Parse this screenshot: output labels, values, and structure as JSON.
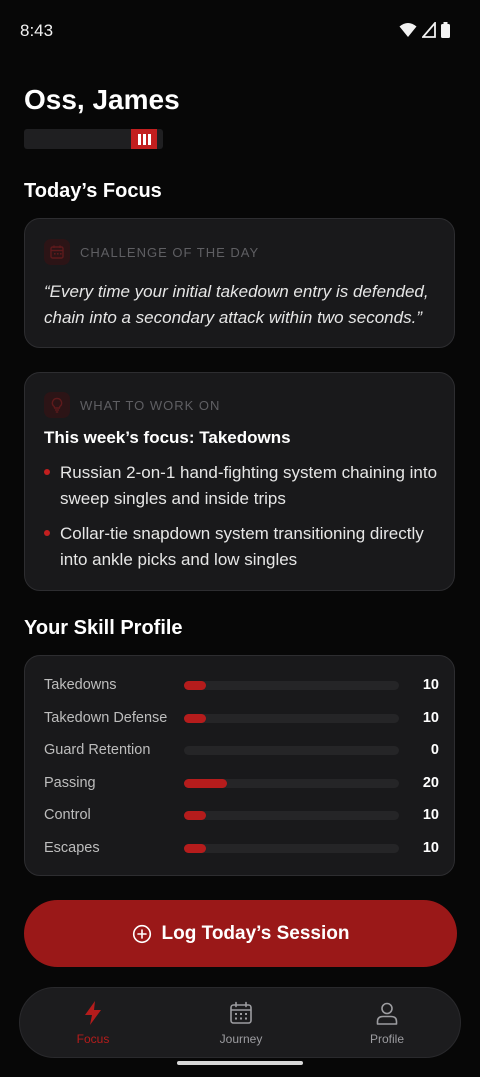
{
  "status": {
    "time": "8:43"
  },
  "header": {
    "greeting": "Oss, James"
  },
  "focus": {
    "title": "Today’s Focus",
    "challenge": {
      "label": "CHALLENGE OF THE DAY",
      "quote": "“Every time your initial takedown entry is defended, chain into a secondary attack within two seconds.”"
    },
    "work_on": {
      "label": "WHAT TO WORK ON",
      "heading": "This week’s focus: Takedowns",
      "items": [
        "Russian 2-on-1 hand-fighting system chaining into sweep singles and inside trips",
        "Collar-tie snapdown system transitioning directly into ankle picks and low singles"
      ]
    }
  },
  "skills": {
    "title": "Your Skill Profile",
    "items": [
      {
        "name": "Takedowns",
        "value": "10",
        "level": 10
      },
      {
        "name": "Takedown Defense",
        "value": "10",
        "level": 10
      },
      {
        "name": "Guard Retention",
        "value": "0",
        "level": 0
      },
      {
        "name": "Passing",
        "value": "20",
        "level": 20
      },
      {
        "name": "Control",
        "value": "10",
        "level": 10
      },
      {
        "name": "Escapes",
        "value": "10",
        "level": 10
      }
    ]
  },
  "action": {
    "log_label": "Log Today’s Session"
  },
  "nav": {
    "items": [
      {
        "label": "Focus",
        "icon": "lightning-bolt-icon",
        "active": true
      },
      {
        "label": "Journey",
        "icon": "calendar-icon",
        "active": false
      },
      {
        "label": "Profile",
        "icon": "person-icon",
        "active": false
      }
    ]
  },
  "colors": {
    "accent": "#b51c1c",
    "background": "#070707",
    "card": "#19191b"
  }
}
